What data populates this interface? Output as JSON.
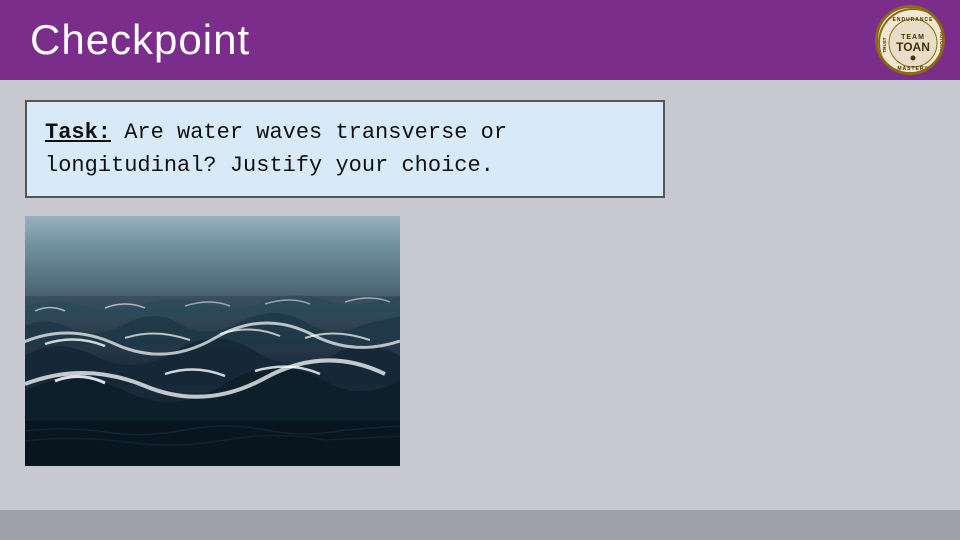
{
  "header": {
    "title": "Checkpoint",
    "background_color": "#7b2d8b"
  },
  "badge": {
    "team_label": "TEAM",
    "team_name": "TOAN"
  },
  "task": {
    "label": "Task:",
    "line1": "Are water waves transverse or",
    "line2": "longitudinal? Justify your choice."
  },
  "image": {
    "alt": "Ocean waves photograph"
  }
}
